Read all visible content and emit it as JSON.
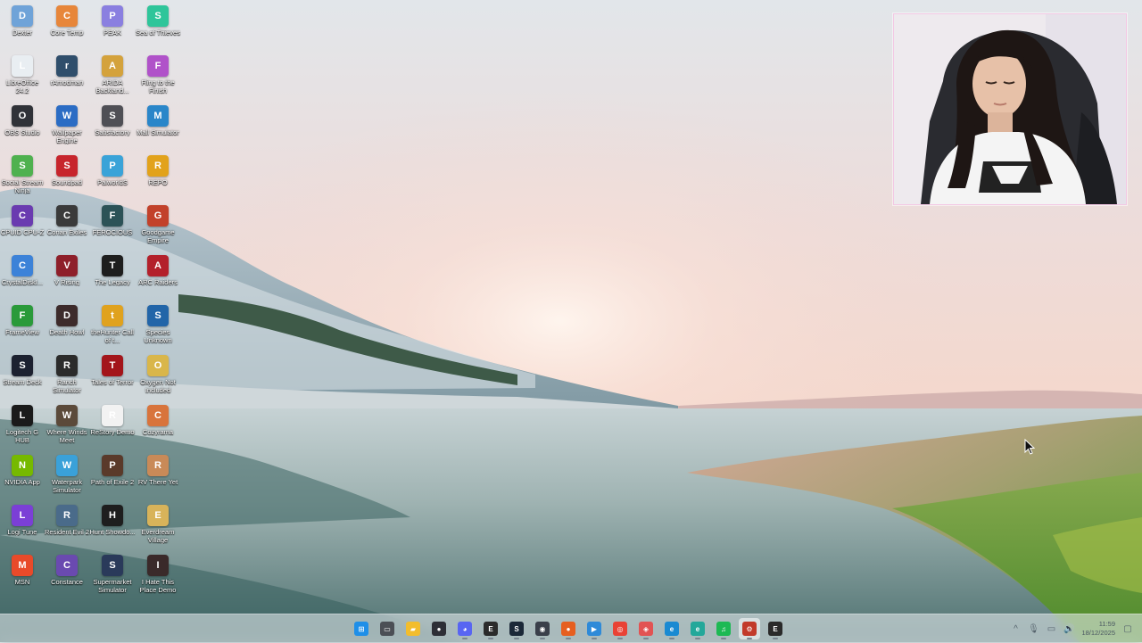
{
  "desktop": {
    "icons": [
      {
        "label": "Dexter",
        "icon": "app-icon",
        "color": "#6fa3d8"
      },
      {
        "label": "Core Temp",
        "icon": "thermometer-icon",
        "color": "#e7863a"
      },
      {
        "label": "PEAK",
        "icon": "mountain-icon",
        "color": "#8a7fe0"
      },
      {
        "label": "Sea of Thieves",
        "icon": "skull-icon",
        "color": "#2ec59a"
      },
      {
        "label": "LibreOffice 24.2",
        "icon": "document-icon",
        "color": "#e9eef2"
      },
      {
        "label": "rAmodman",
        "icon": "r-icon",
        "color": "#2f4e6b"
      },
      {
        "label": "ARIDA Backland...",
        "icon": "triangle-icon",
        "color": "#d4a23c"
      },
      {
        "label": "Fling to the Finish",
        "icon": "swirl-icon",
        "color": "#b052c9"
      },
      {
        "label": "OBS Studio",
        "icon": "obs-icon",
        "color": "#303238"
      },
      {
        "label": "Wallpaper Engine",
        "icon": "gear-icon",
        "color": "#2b6cc4"
      },
      {
        "label": "Satisfactory",
        "icon": "s-icon",
        "color": "#4f4f55"
      },
      {
        "label": "Mall Simulator",
        "icon": "chart-icon",
        "color": "#2a86c9"
      },
      {
        "label": "Social Stream Ninja",
        "icon": "ninja-icon",
        "color": "#4fb14f"
      },
      {
        "label": "Soundpad",
        "icon": "play-icon",
        "color": "#c7252c"
      },
      {
        "label": "PalworldS",
        "icon": "creature-icon",
        "color": "#3aa3d8"
      },
      {
        "label": "REPO",
        "icon": "robot-icon",
        "color": "#e2a21b"
      },
      {
        "label": "CPUID CPU-Z",
        "icon": "chip-icon",
        "color": "#6a3bb0"
      },
      {
        "label": "Conan Exiles",
        "icon": "sword-icon",
        "color": "#3a3a3a"
      },
      {
        "label": "FEROCIOUS",
        "icon": "dinosaur-icon",
        "color": "#2c5257"
      },
      {
        "label": "Goodgame Empire",
        "icon": "castle-icon",
        "color": "#c2412a"
      },
      {
        "label": "CrystalDiskI...",
        "icon": "disk-icon",
        "color": "#3c82d8"
      },
      {
        "label": "V Rising",
        "icon": "fang-icon",
        "color": "#8e1f2a"
      },
      {
        "label": "The Legacy",
        "icon": "g-icon",
        "color": "#1e1e1e"
      },
      {
        "label": "ARC Raiders",
        "icon": "arc-icon",
        "color": "#b3202b"
      },
      {
        "label": "FrameView",
        "icon": "frame-icon",
        "color": "#2a9a3a"
      },
      {
        "label": "Death Howl",
        "icon": "wolf-icon",
        "color": "#3d2b2b"
      },
      {
        "label": "theHunter Call of t...",
        "icon": "deer-icon",
        "color": "#e0a21e"
      },
      {
        "label": "Species Unknown",
        "icon": "su-icon",
        "color": "#2265a8"
      },
      {
        "label": "Stream Deck",
        "icon": "grid-icon",
        "color": "#1c2130"
      },
      {
        "label": "Ranch Simulator",
        "icon": "rs-icon",
        "color": "#2b2b2b"
      },
      {
        "label": "Tales of Terror",
        "icon": "ghost-icon",
        "color": "#a3151b"
      },
      {
        "label": "Oxygen Not Included",
        "icon": "bubble-icon",
        "color": "#d9b64a"
      },
      {
        "label": "Logitech G HUB",
        "icon": "g-hub-icon",
        "color": "#1a1a1a"
      },
      {
        "label": "Where Winds Meet",
        "icon": "wind-icon",
        "color": "#5b4a3a"
      },
      {
        "label": "ReStory Demo",
        "icon": "page-icon",
        "color": "#f2f2f2"
      },
      {
        "label": "Cozyrama",
        "icon": "house-icon",
        "color": "#d8743c"
      },
      {
        "label": "NVIDIA App",
        "icon": "nvidia-icon",
        "color": "#76b900"
      },
      {
        "label": "Waterpark Simulator",
        "icon": "water-icon",
        "color": "#3aa1d9"
      },
      {
        "label": "Path of Exile 2",
        "icon": "poe-icon",
        "color": "#5a3a2a"
      },
      {
        "label": "RV There Yet",
        "icon": "rv-icon",
        "color": "#c98a58"
      },
      {
        "label": "Logi Tune",
        "icon": "headset-icon",
        "color": "#7b3fd6"
      },
      {
        "label": "Resident Evil 2",
        "icon": "re-icon",
        "color": "#4a6b8a"
      },
      {
        "label": "Hunt Showdo...",
        "icon": "target-icon",
        "color": "#1e1e1e"
      },
      {
        "label": "Everdream Village",
        "icon": "village-icon",
        "color": "#d8b35a"
      },
      {
        "label": "MSN",
        "icon": "msn-icon",
        "color": "#e84a2a"
      },
      {
        "label": "Constance",
        "icon": "brush-icon",
        "color": "#6a4ab0"
      },
      {
        "label": "Supermarket Simulator",
        "icon": "cart-icon",
        "color": "#2a3a5a"
      },
      {
        "label": "I Hate This Place Demo",
        "icon": "face-icon",
        "color": "#3a2a2a"
      }
    ]
  },
  "taskbar": {
    "apps": [
      {
        "name": "windows-start-icon",
        "color": "#1f8fe8",
        "glyph": "⊞"
      },
      {
        "name": "task-view-icon",
        "color": "#4b4f55",
        "glyph": "▭"
      },
      {
        "name": "file-explorer-icon",
        "color": "#f2bd2c",
        "glyph": "▰"
      },
      {
        "name": "app-dark-icon",
        "color": "#2d2f36",
        "glyph": "●"
      },
      {
        "name": "discord-icon",
        "color": "#5865f2",
        "glyph": "◕"
      },
      {
        "name": "epic-games-icon",
        "color": "#2b2b2b",
        "glyph": "E"
      },
      {
        "name": "steam-icon",
        "color": "#1b2838",
        "glyph": "S"
      },
      {
        "name": "obs-icon",
        "color": "#3a3f4a",
        "glyph": "◉"
      },
      {
        "name": "firefox-icon",
        "color": "#e65f20",
        "glyph": "●"
      },
      {
        "name": "streamlabs-icon",
        "color": "#2e8ad8",
        "glyph": "▶"
      },
      {
        "name": "chrome-icon",
        "color": "#e94235",
        "glyph": "◎"
      },
      {
        "name": "app-red-icon",
        "color": "#e25353",
        "glyph": "◈"
      },
      {
        "name": "edge-icon",
        "color": "#1a8ad2",
        "glyph": "e"
      },
      {
        "name": "edge-dev-icon",
        "color": "#23a89a",
        "glyph": "e"
      },
      {
        "name": "spotify-icon",
        "color": "#1db954",
        "glyph": "♫"
      },
      {
        "name": "steam-active-icon",
        "color": "#c23a2a",
        "glyph": "⚙"
      },
      {
        "name": "epic-launcher-icon",
        "color": "#2a2a2a",
        "glyph": "E"
      }
    ],
    "active_index": 15,
    "tray": {
      "chevron": "^",
      "mic": "🎙",
      "network": "▭",
      "volume": "🔊",
      "time": "11:59",
      "date": "18/12/2025",
      "notification": "▢"
    }
  }
}
